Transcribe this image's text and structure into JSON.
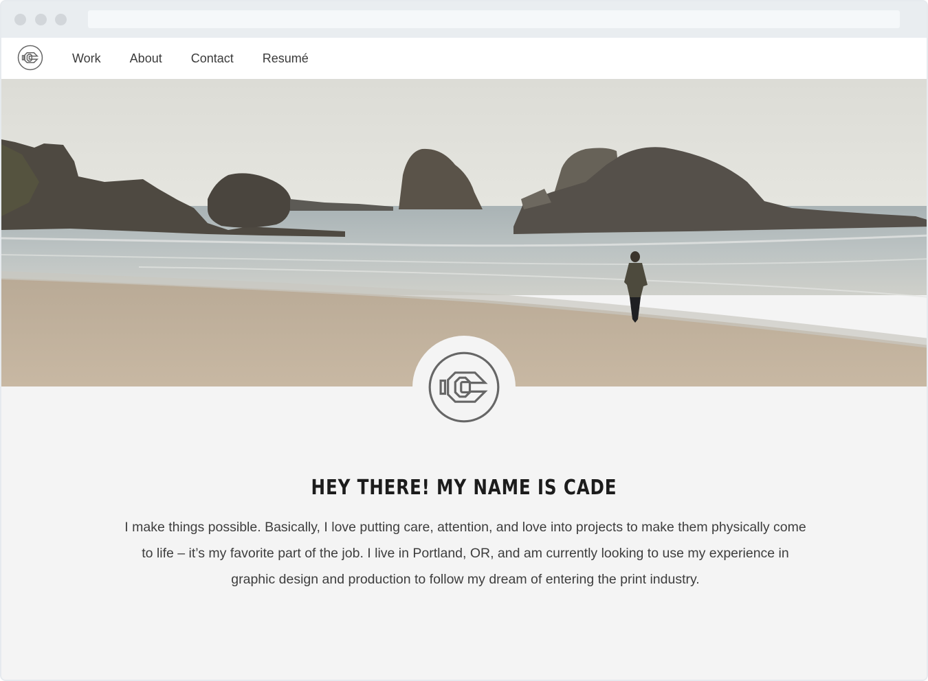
{
  "browser": {
    "window_dots": [
      "close",
      "minimize",
      "maximize"
    ],
    "url_text": ""
  },
  "nav": {
    "logo_icon": "cade-monogram-icon",
    "items": [
      {
        "label": "Work"
      },
      {
        "label": "About"
      },
      {
        "label": "Contact"
      },
      {
        "label": "Resumé"
      }
    ]
  },
  "hero": {
    "image": "beach-sea-stacks-photo"
  },
  "intro": {
    "badge_icon": "cade-monogram-icon",
    "headline": "HEY THERE! MY NAME IS CADE",
    "bio": "I make things possible. Basically, I love putting care, attention, and love into projects to make them physically come to life – it’s my favorite part of the job. I live in Portland, OR, and am currently looking to use my experience in graphic design and production to follow my dream of entering the print industry."
  },
  "colors": {
    "chrome": "#e9edf0",
    "nav_bg": "#ffffff",
    "content_bg": "#f4f4f4",
    "headline": "#1c1c1c",
    "body_text": "#3d3d3d",
    "logo_stroke": "#666666"
  }
}
